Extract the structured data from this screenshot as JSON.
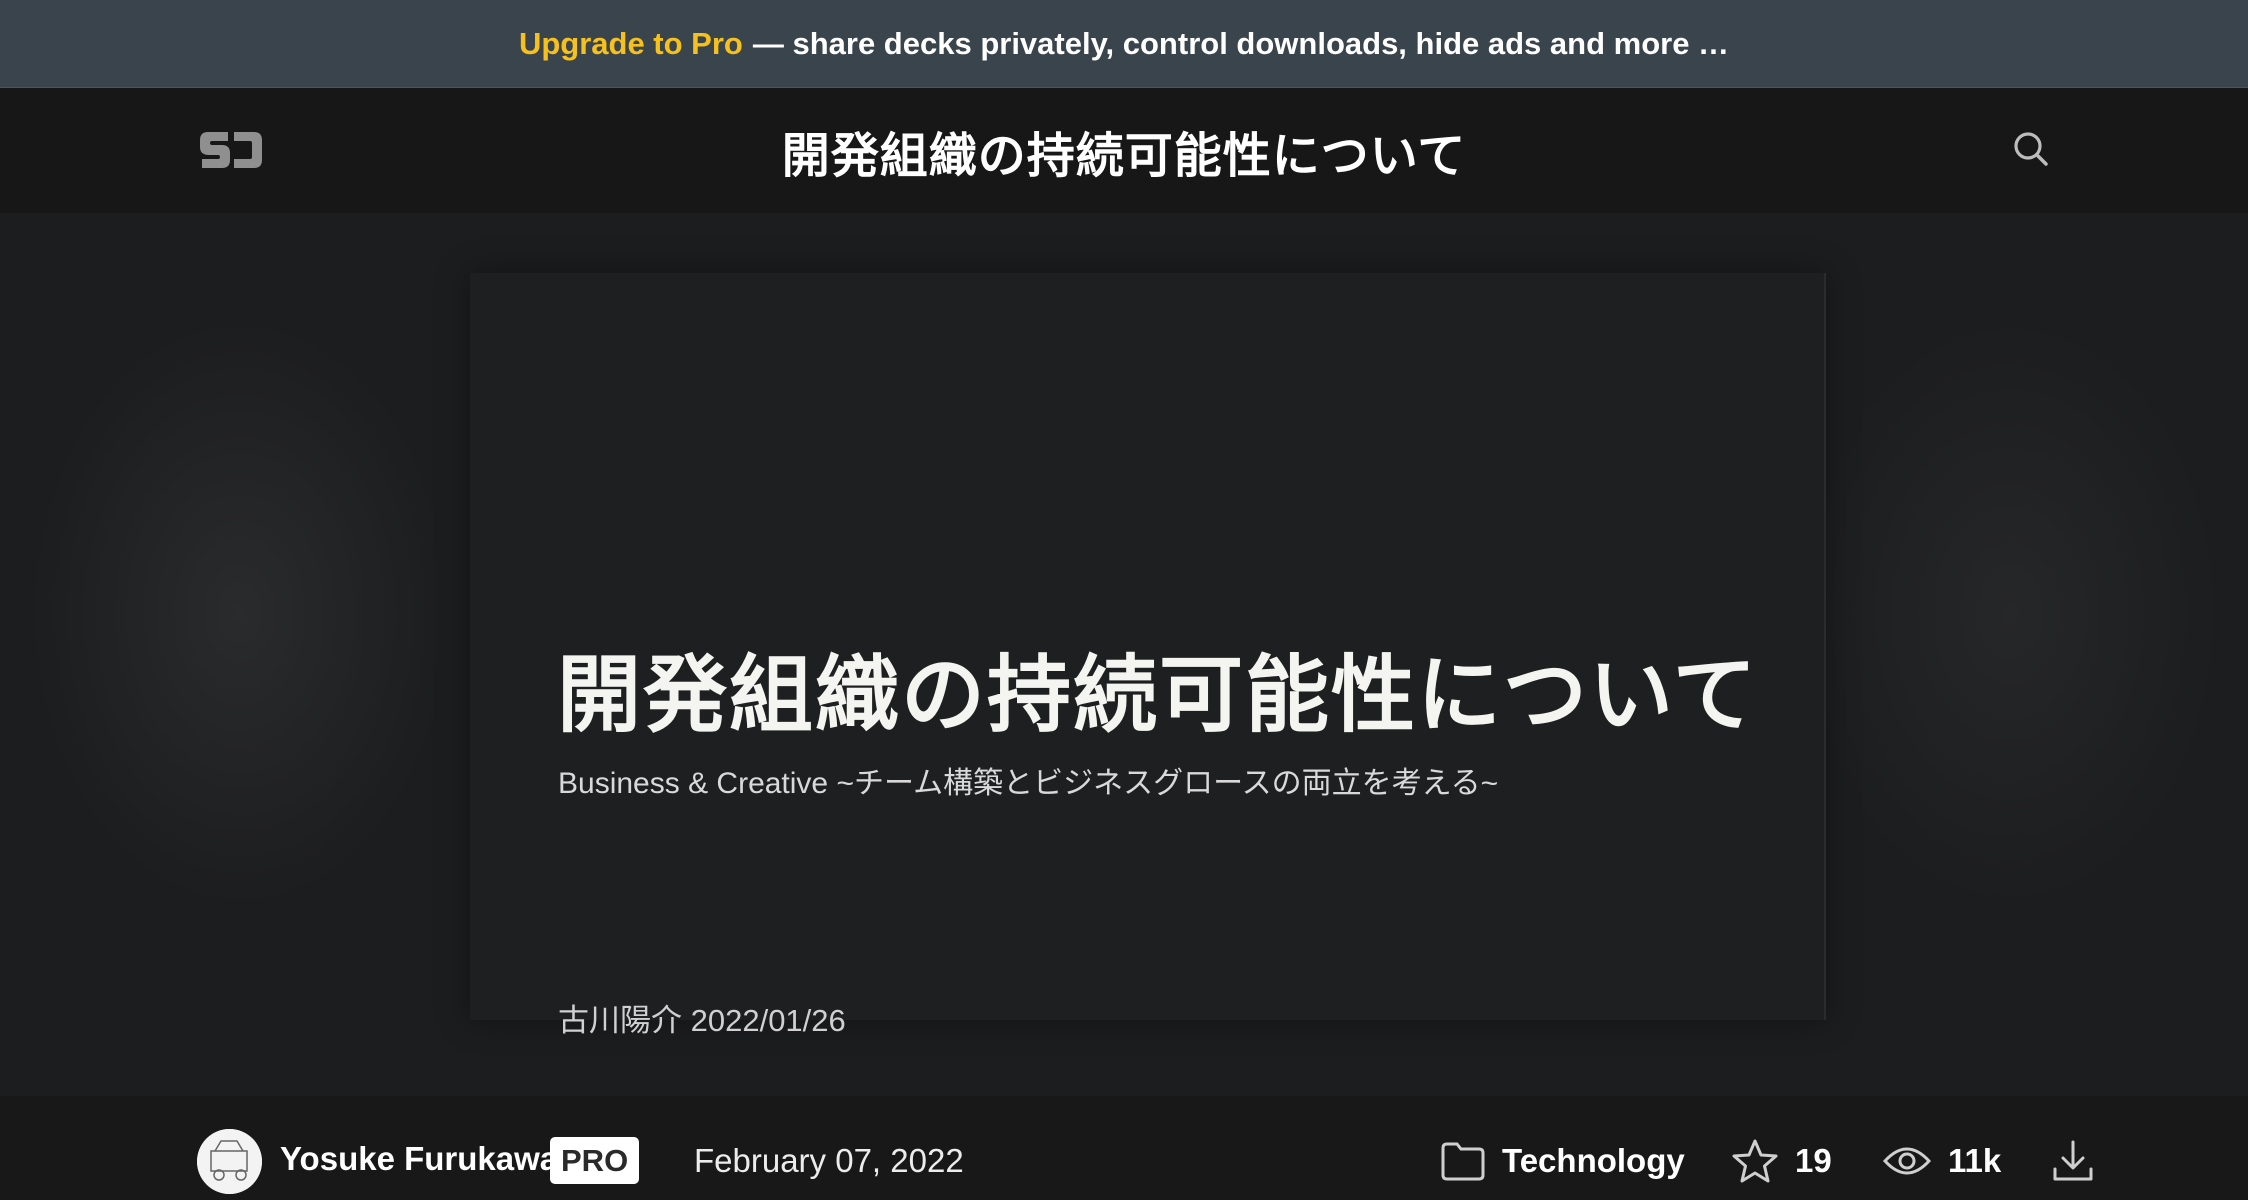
{
  "promo": {
    "highlight": "Upgrade to Pro",
    "text": "— share decks privately, control downloads, hide ads and more …"
  },
  "header": {
    "logo_icon": "speakerdeck-logo-icon",
    "title": "開発組織の持続可能性について",
    "search_icon": "search-icon"
  },
  "slide": {
    "title": "開発組織の持続可能性について",
    "subtitle": "Business & Creative ~チーム構築とビジネスグロースの両立を考える~",
    "author_line": "古川陽介 2022/01/26"
  },
  "footer": {
    "author": "Yosuke Furukawa",
    "badge": "PRO",
    "date": "February 07, 2022",
    "category": "Technology",
    "stars": "19",
    "views": "11k",
    "icons": [
      "folder-icon",
      "star-icon",
      "eye-icon",
      "download-icon"
    ]
  },
  "colors": {
    "promo_bg": "#3a444c",
    "accent": "#f6c11c",
    "header_bg": "#171717",
    "slide_bg": "#1d1f21"
  }
}
